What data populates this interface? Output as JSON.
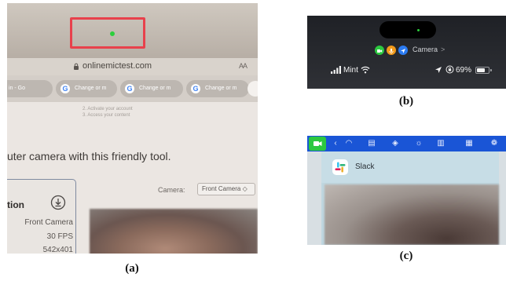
{
  "panel_a": {
    "caption": "(a)",
    "url": "onlinemictest.com",
    "text_size_button": "AA",
    "tabs": [
      {
        "label": "in - Go"
      },
      {
        "label": "Change or m"
      },
      {
        "label": "Change or m"
      },
      {
        "label": "Change or m"
      }
    ],
    "steps": [
      "2. Activate your account",
      "3. Access your content"
    ],
    "headline": "uter camera with this friendly tool.",
    "card_title": "tion",
    "specs": [
      "Front Camera",
      "30 FPS",
      "542x401"
    ],
    "camera_label": "Camera:",
    "camera_select": "Front Camera ◇"
  },
  "panel_b": {
    "caption": "(b)",
    "indicator_label": "Camera",
    "carrier": "Mint",
    "battery_text": "69%",
    "battery_level": 0.69
  },
  "panel_c": {
    "caption": "(c)",
    "app_name": "Slack"
  },
  "colors": {
    "recording_indicator": "#2ccf3c",
    "highlight_box": "#e8414c",
    "mac_menubar": "#1a55d6"
  }
}
